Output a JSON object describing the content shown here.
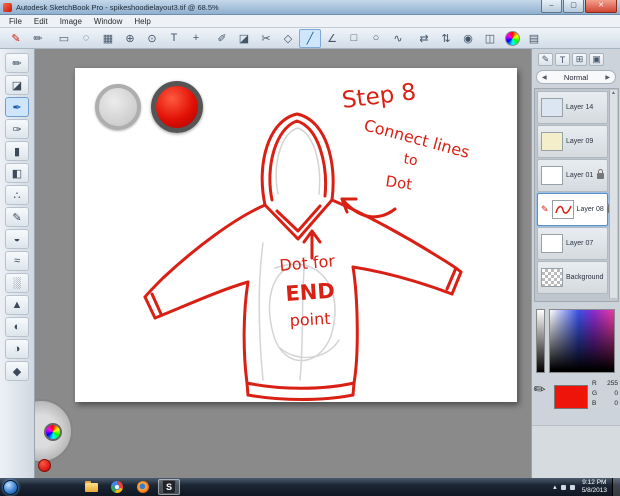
{
  "window": {
    "title": "Autodesk SketchBook Pro - spikeshoodielayout3.tif @ 68.5%",
    "minimize": "–",
    "maximize": "▢",
    "close": "✕"
  },
  "menu": {
    "items": [
      "File",
      "Edit",
      "Image",
      "Window",
      "Help"
    ]
  },
  "toolbar": {
    "icons": [
      {
        "name": "brush-library",
        "glyph": "✎"
      },
      {
        "name": "brush-editor",
        "glyph": "✏"
      },
      {
        "name": "marquee-select",
        "glyph": "▭"
      },
      {
        "name": "lasso-select",
        "glyph": "◌"
      },
      {
        "name": "crop",
        "glyph": "▦"
      },
      {
        "name": "zoom",
        "glyph": "⊕"
      },
      {
        "name": "magnifier",
        "glyph": "⊙"
      },
      {
        "name": "text-tool",
        "glyph": "T"
      },
      {
        "name": "move-tool",
        "glyph": "+"
      },
      {
        "name": "pencil-tool",
        "glyph": "✐"
      },
      {
        "name": "eraser-tool",
        "glyph": "◪"
      },
      {
        "name": "cut-tool",
        "glyph": "✂"
      },
      {
        "name": "transform-tool",
        "glyph": "◇"
      },
      {
        "name": "line-tool",
        "glyph": "╱"
      },
      {
        "name": "polyline-tool",
        "glyph": "∠"
      },
      {
        "name": "rectangle-tool",
        "glyph": "□"
      },
      {
        "name": "ellipse-tool",
        "glyph": "○"
      },
      {
        "name": "curve-tool",
        "glyph": "∿"
      },
      {
        "name": "flip-horizontal",
        "glyph": "⇄"
      },
      {
        "name": "flip-vertical",
        "glyph": "⇅"
      },
      {
        "name": "steady-stroke",
        "glyph": "◉"
      },
      {
        "name": "symmetry",
        "glyph": "◫"
      },
      {
        "name": "color-wheel",
        "glyph": ""
      },
      {
        "name": "brush-sets",
        "glyph": "▤"
      }
    ]
  },
  "left_tools": {
    "items": [
      {
        "name": "pencil",
        "glyph": "✏"
      },
      {
        "name": "eraser",
        "glyph": "◪"
      },
      {
        "name": "pen",
        "glyph": "✒"
      },
      {
        "name": "ballpoint",
        "glyph": "✑"
      },
      {
        "name": "marker",
        "glyph": "▮"
      },
      {
        "name": "chisel",
        "glyph": "◧"
      },
      {
        "name": "airbrush",
        "glyph": "∴"
      },
      {
        "name": "paintbrush",
        "glyph": "✎"
      },
      {
        "name": "flood-fill",
        "glyph": "◒"
      },
      {
        "name": "smear",
        "glyph": "≈"
      },
      {
        "name": "blur",
        "glyph": "░"
      },
      {
        "name": "sharpen",
        "glyph": "▲"
      },
      {
        "name": "dodge",
        "glyph": "◐"
      },
      {
        "name": "burn",
        "glyph": "◑"
      },
      {
        "name": "custom-brush",
        "glyph": "◆"
      }
    ]
  },
  "canvas": {
    "ink_color": "#d92015",
    "annotations": {
      "step": "Step 8",
      "connect_lines": "Connect lines",
      "to": "to",
      "dot": "Dot",
      "dot_for": "Dot for",
      "end": "END",
      "point": "point"
    }
  },
  "panel_toolbar": {
    "icons": [
      {
        "name": "pencil",
        "glyph": "✎"
      },
      {
        "name": "text",
        "glyph": "T"
      },
      {
        "name": "add-layer",
        "glyph": "⊞"
      },
      {
        "name": "layer-options",
        "glyph": "▣"
      }
    ]
  },
  "layers_panel": {
    "prev": "◀",
    "next": "▶",
    "blend_mode": "Normal",
    "edit_indicator": "✎",
    "scroll_up": "▲",
    "scroll_down": "▼",
    "layers": [
      {
        "name": "Layer 14"
      },
      {
        "name": "Layer 09"
      },
      {
        "name": "Layer 01"
      },
      {
        "name": "Layer 08"
      },
      {
        "name": "Layer 07"
      },
      {
        "name": "Background"
      }
    ]
  },
  "color_editor": {
    "pencil_glyph": "✎",
    "r_label": "R",
    "r_value": "255",
    "g_label": "G",
    "g_value": "0",
    "b_label": "B",
    "b_value": "0",
    "swatch_color": "#ee1409"
  },
  "taskbar": {
    "sketchbook_initial": "S",
    "tray_expand": "▴",
    "time": "9:12 PM",
    "date": "5/8/2013"
  }
}
